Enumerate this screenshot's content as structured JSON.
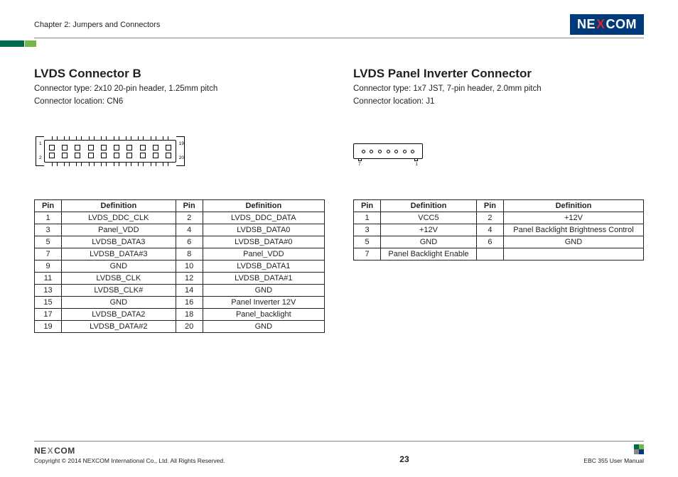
{
  "header": {
    "chapter_title": "Chapter 2: Jumpers and Connectors",
    "logo_pre": "NE",
    "logo_x": "X",
    "logo_post": "COM"
  },
  "left": {
    "title": "LVDS Connector B",
    "desc1": "Connector type: 2x10 20-pin header, 1.25mm pitch",
    "desc2": "Connector location: CN6",
    "diagram": {
      "p1": "1",
      "p2": "2",
      "p19": "19",
      "p20": "20"
    },
    "th_pin": "Pin",
    "th_def": "Definition",
    "rows": [
      {
        "p1": "1",
        "d1": "LVDS_DDC_CLK",
        "p2": "2",
        "d2": "LVDS_DDC_DATA"
      },
      {
        "p1": "3",
        "d1": "Panel_VDD",
        "p2": "4",
        "d2": "LVDSB_DATA0"
      },
      {
        "p1": "5",
        "d1": "LVDSB_DATA3",
        "p2": "6",
        "d2": "LVDSB_DATA#0"
      },
      {
        "p1": "7",
        "d1": "LVDSB_DATA#3",
        "p2": "8",
        "d2": "Panel_VDD"
      },
      {
        "p1": "9",
        "d1": "GND",
        "p2": "10",
        "d2": "LVDSB_DATA1"
      },
      {
        "p1": "11",
        "d1": "LVDSB_CLK",
        "p2": "12",
        "d2": "LVDSB_DATA#1"
      },
      {
        "p1": "13",
        "d1": "LVDSB_CLK#",
        "p2": "14",
        "d2": "GND"
      },
      {
        "p1": "15",
        "d1": "GND",
        "p2": "16",
        "d2": "Panel Inverter 12V"
      },
      {
        "p1": "17",
        "d1": "LVDSB_DATA2",
        "p2": "18",
        "d2": "Panel_backlight"
      },
      {
        "p1": "19",
        "d1": "LVDSB_DATA#2",
        "p2": "20",
        "d2": "GND"
      }
    ]
  },
  "right": {
    "title": "LVDS Panel Inverter Connector",
    "desc1": "Connector type: 1x7 JST, 7-pin header, 2.0mm pitch",
    "desc2": "Connector location: J1",
    "diagram": {
      "p7": "7",
      "p1": "1"
    },
    "th_pin": "Pin",
    "th_def": "Definition",
    "rows": [
      {
        "p1": "1",
        "d1": "VCC5",
        "p2": "2",
        "d2": "+12V"
      },
      {
        "p1": "3",
        "d1": "+12V",
        "p2": "4",
        "d2": "Panel Backlight Brightness Control"
      },
      {
        "p1": "5",
        "d1": "GND",
        "p2": "6",
        "d2": "GND"
      },
      {
        "p1": "7",
        "d1": "Panel Backlight Enable",
        "p2": "",
        "d2": ""
      }
    ]
  },
  "footer": {
    "logo_pre": "NE",
    "logo_x": "X",
    "logo_post": "COM",
    "copyright": "Copyright © 2014 NEXCOM International Co., Ltd. All Rights Reserved.",
    "page": "23",
    "manual": "EBC 355 User Manual"
  }
}
